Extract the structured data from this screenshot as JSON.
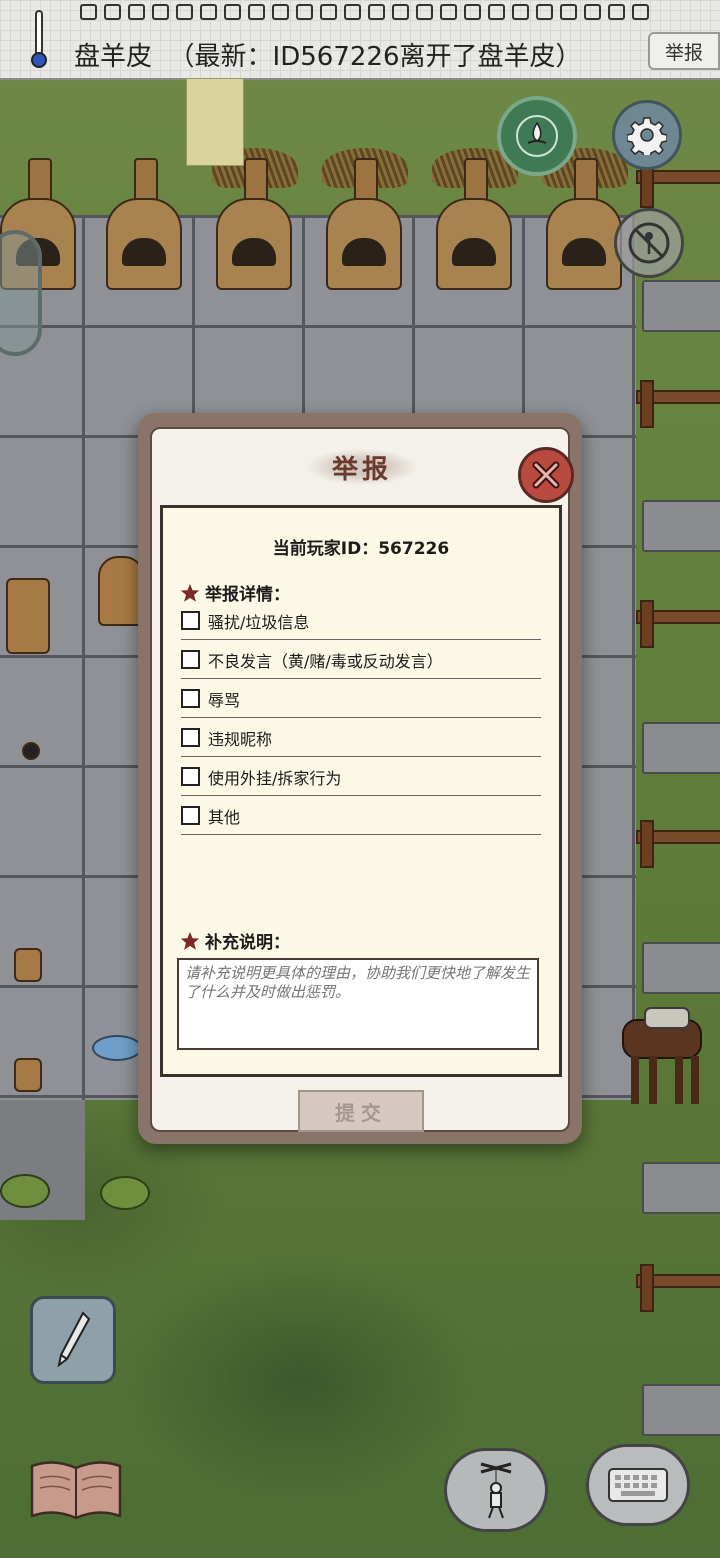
{
  "hud": {
    "biome_label": "盘羊皮",
    "latest_event": "（最新：ID567226离开了盘羊皮）",
    "report_button": "举报"
  },
  "icons": {
    "thermometer": "thermometer-icon",
    "compass": "compass-icon",
    "settings": "gear-icon",
    "no_entry": "no-entry-icon",
    "pencil": "pencil-icon",
    "book": "book-icon",
    "puppet": "puppet-icon",
    "keyboard": "keyboard-icon",
    "close": "close-icon",
    "star": "star-icon"
  },
  "dialog": {
    "title": "举报",
    "player_id": "当前玩家ID：567226",
    "details_label": "举报详情：",
    "options": [
      {
        "label": "骚扰/垃圾信息",
        "checked": false
      },
      {
        "label": "不良发言（黄/赌/毒或反动发言）",
        "checked": false
      },
      {
        "label": "辱骂",
        "checked": false
      },
      {
        "label": "违规昵称",
        "checked": false
      },
      {
        "label": "使用外挂/拆家行为",
        "checked": false
      },
      {
        "label": "其他",
        "checked": false
      }
    ],
    "notes_label": "补充说明：",
    "notes_placeholder": "请补充说明更具体的理由，协助我们更快地了解发生了什么并及时做出惩罚。",
    "notes_value": "",
    "submit_label": "提交",
    "submit_enabled": false
  },
  "colors": {
    "dialog_frame": "#8a7368",
    "panel_bg": "#fbf8e6",
    "close_button": "#b94a3f",
    "title_text": "#6b3a2e"
  }
}
